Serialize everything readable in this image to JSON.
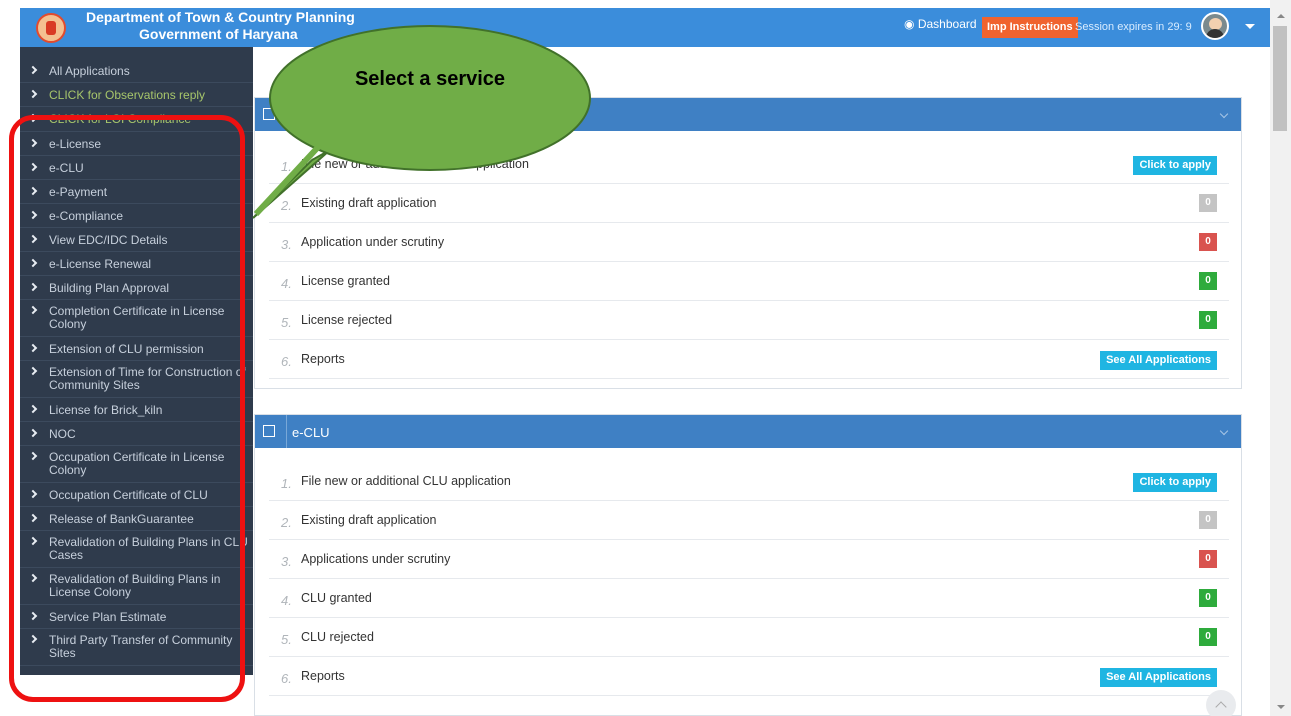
{
  "header": {
    "title_line1": "Department of Town & Country Planning",
    "title_line2": "Government of Haryana",
    "dashboard": "Dashboard",
    "imp_instructions": "Imp Instructions",
    "session": "Session expires in 29: 9",
    "logo_icon": "haryana-emblem-icon",
    "avatar_icon": "user-avatar-icon"
  },
  "sidebar": {
    "items": [
      {
        "label": "All Applications"
      },
      {
        "label": "CLICK for Observations reply"
      },
      {
        "label": "CLICK for LOI Compliance"
      },
      {
        "label": "e-License"
      },
      {
        "label": "e-CLU"
      },
      {
        "label": "e-Payment"
      },
      {
        "label": "e-Compliance"
      },
      {
        "label": "View EDC/IDC Details"
      },
      {
        "label": "e-License Renewal"
      },
      {
        "label": "Building Plan Approval"
      },
      {
        "label": "Completion Certificate in License Colony"
      },
      {
        "label": "Extension of CLU permission"
      },
      {
        "label": "Extension of Time for Construction of Community Sites"
      },
      {
        "label": "License for Brick_kiln"
      },
      {
        "label": "NOC"
      },
      {
        "label": "Occupation Certificate in License Colony"
      },
      {
        "label": "Occupation Certificate of CLU"
      },
      {
        "label": "Release of BankGuarantee"
      },
      {
        "label": "Revalidation of Building Plans in CLU Cases"
      },
      {
        "label": "Revalidation of Building Plans in License Colony"
      },
      {
        "label": "Service Plan Estimate"
      },
      {
        "label": "Third Party Transfer of Community Sites"
      }
    ]
  },
  "callout": {
    "text": "Select a service"
  },
  "license_panel": {
    "title": "",
    "rows": [
      {
        "num": "1.",
        "text": "File new or additional License application",
        "action": "Click to apply"
      },
      {
        "num": "2.",
        "text": "Existing draft application",
        "badge": "0"
      },
      {
        "num": "3.",
        "text": "Application under scrutiny",
        "badge": "0"
      },
      {
        "num": "4.",
        "text": "License granted",
        "badge": "0"
      },
      {
        "num": "5.",
        "text": "License rejected",
        "badge": "0"
      },
      {
        "num": "6.",
        "text": "Reports",
        "action": "See All Applications"
      }
    ]
  },
  "clu_panel": {
    "title": "e-CLU",
    "rows": [
      {
        "num": "1.",
        "text": "File new or additional CLU application",
        "action": "Click to apply"
      },
      {
        "num": "2.",
        "text": "Existing draft application",
        "badge": "0"
      },
      {
        "num": "3.",
        "text": "Applications under scrutiny",
        "badge": "0"
      },
      {
        "num": "4.",
        "text": "CLU granted",
        "badge": "0"
      },
      {
        "num": "5.",
        "text": "CLU rejected",
        "badge": "0"
      },
      {
        "num": "6.",
        "text": "Reports",
        "action": "See All Applications"
      }
    ]
  },
  "colors": {
    "header_blue": "#3b8ddb",
    "sidebar_bg": "#2f3b4c",
    "panel_head": "#3f80c4",
    "callout_fill": "#70ad47",
    "annotation_red": "#ee1111",
    "action_cyan": "#1fb5e2"
  }
}
